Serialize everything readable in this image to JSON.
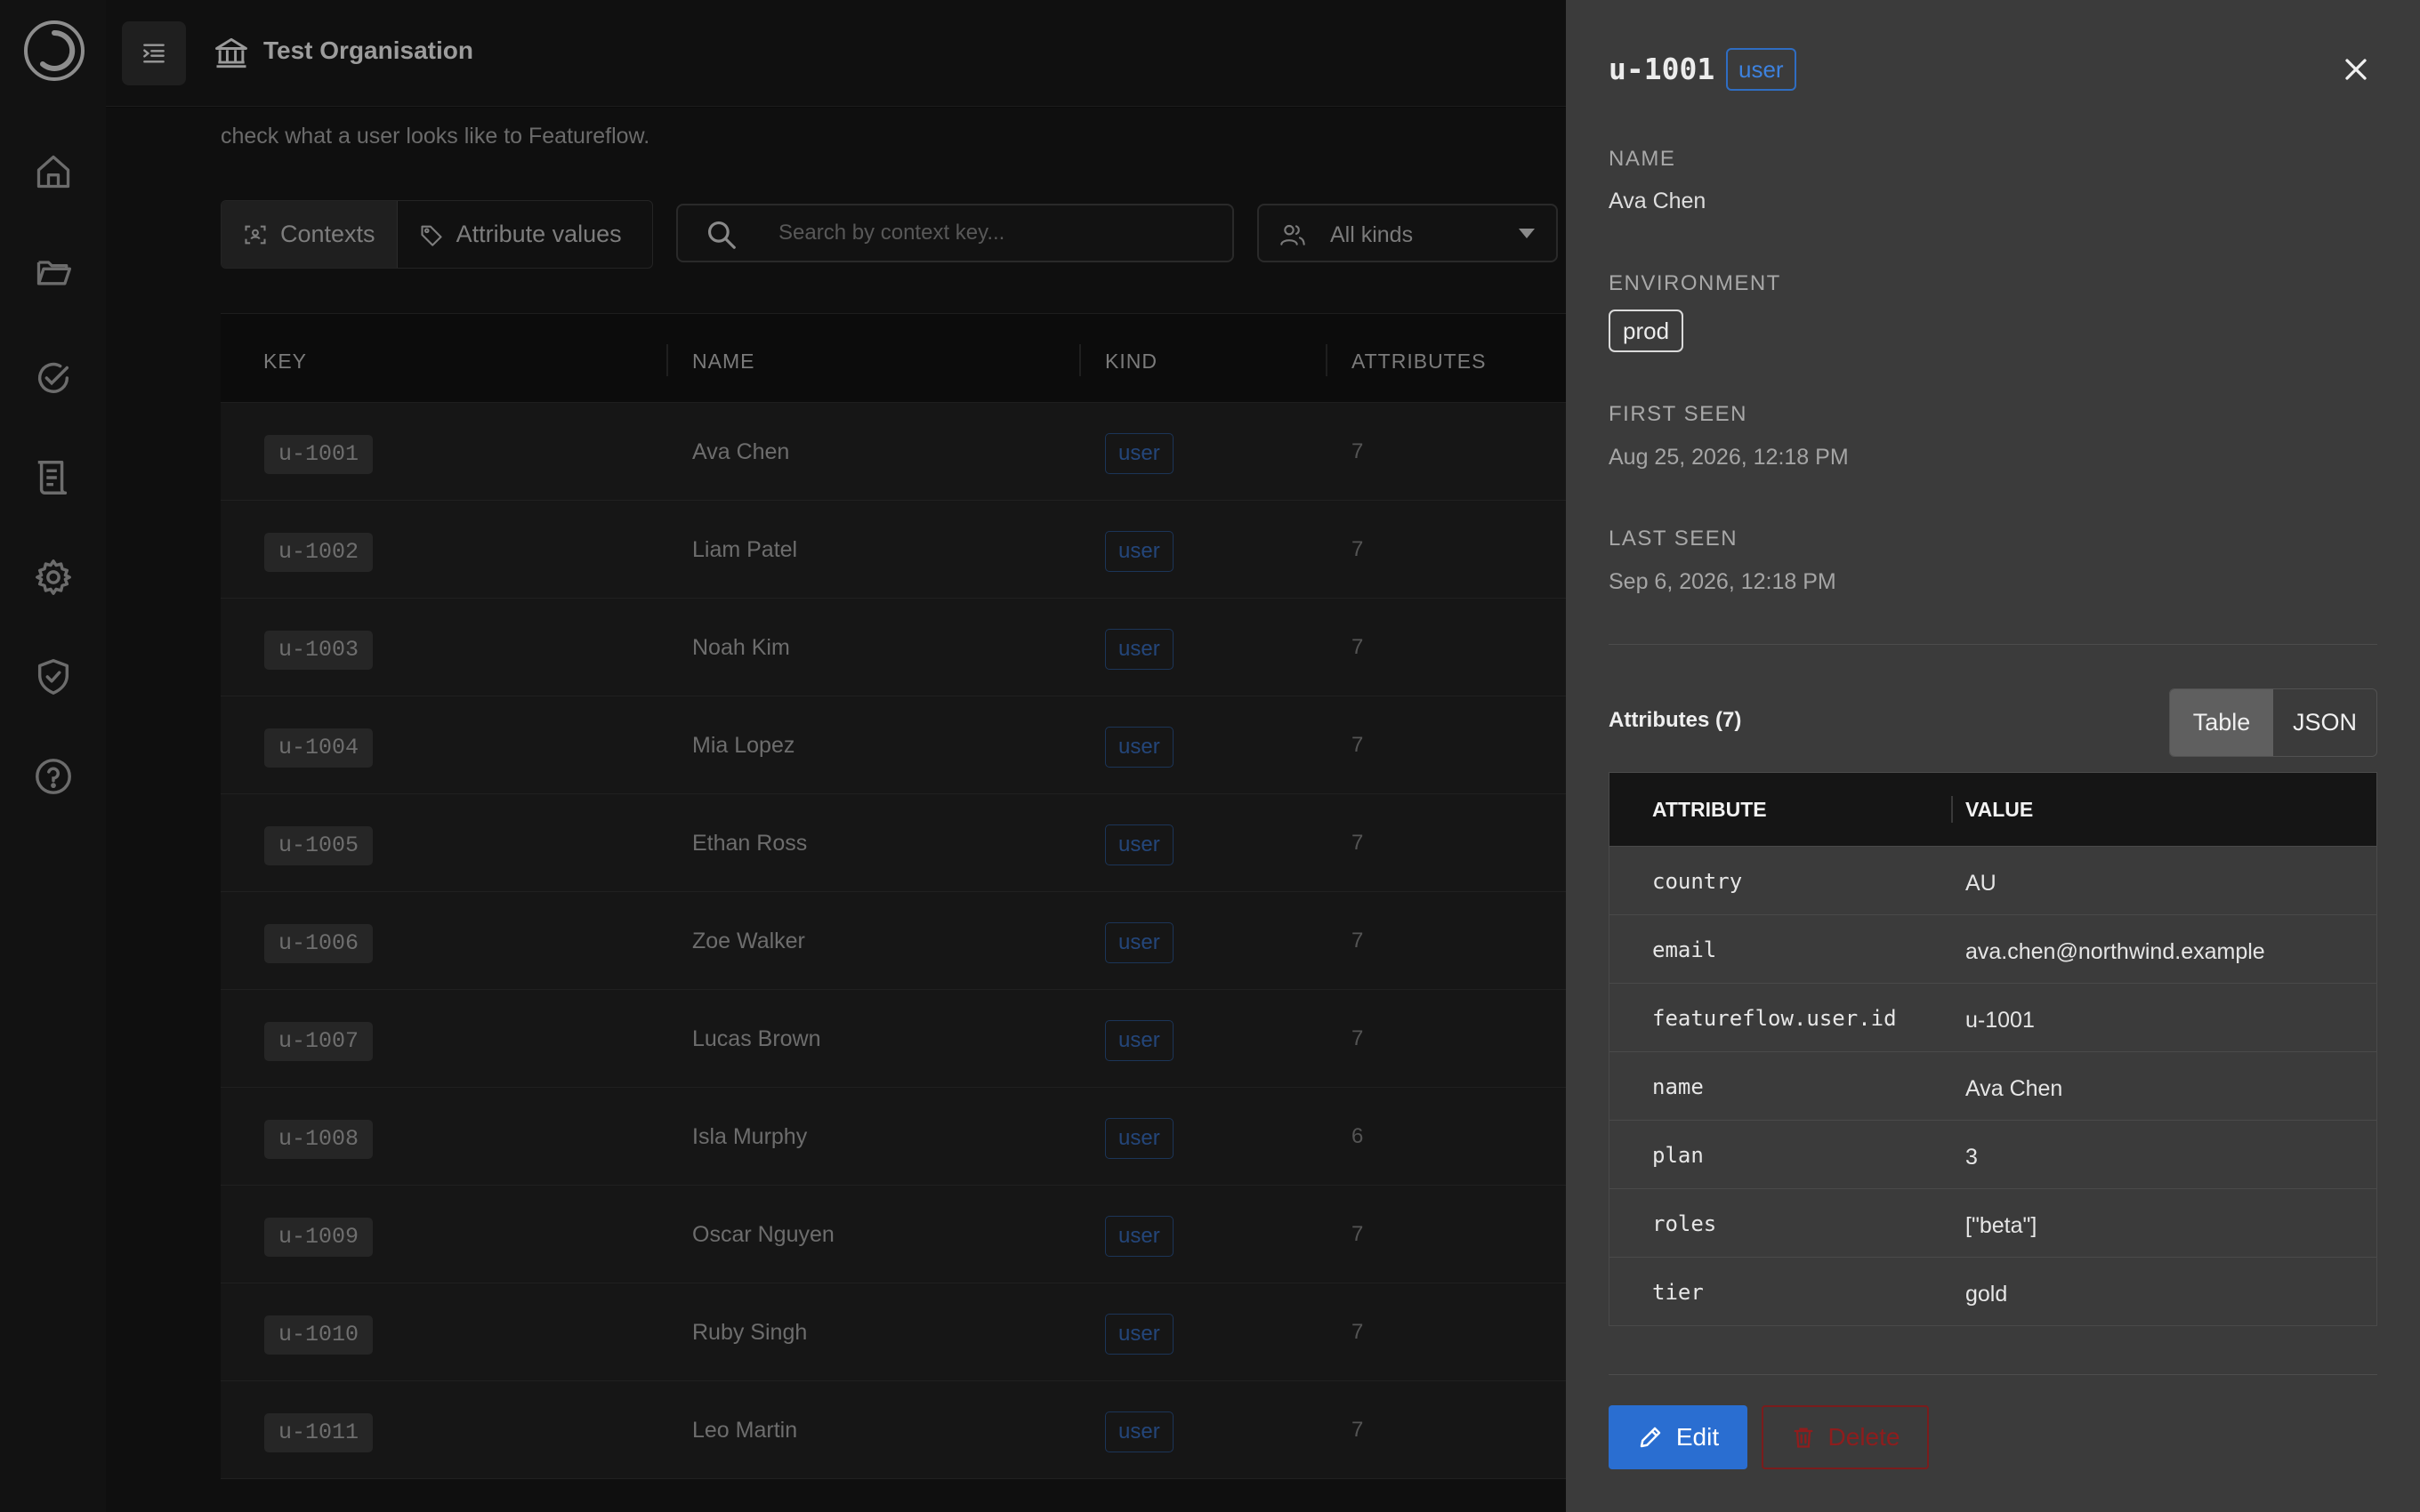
{
  "topbar": {
    "org_name": "Test Organisation"
  },
  "main": {
    "intro_text": "check what a user looks like to Featureflow.",
    "tabs": [
      {
        "label": "Contexts",
        "icon": "context-scan-icon",
        "active": true
      },
      {
        "label": "Attribute values",
        "icon": "tag-icon",
        "active": false
      }
    ],
    "search": {
      "placeholder": "Search by context key...",
      "value": ""
    },
    "kind_filter": {
      "selected": "All kinds"
    },
    "table": {
      "columns": [
        "KEY",
        "NAME",
        "KIND",
        "ATTRIBUTES"
      ],
      "rows": [
        {
          "key": "u-1001",
          "name": "Ava Chen",
          "kind": "user",
          "attributes": "7"
        },
        {
          "key": "u-1002",
          "name": "Liam Patel",
          "kind": "user",
          "attributes": "7"
        },
        {
          "key": "u-1003",
          "name": "Noah Kim",
          "kind": "user",
          "attributes": "7"
        },
        {
          "key": "u-1004",
          "name": "Mia Lopez",
          "kind": "user",
          "attributes": "7"
        },
        {
          "key": "u-1005",
          "name": "Ethan Ross",
          "kind": "user",
          "attributes": "7"
        },
        {
          "key": "u-1006",
          "name": "Zoe Walker",
          "kind": "user",
          "attributes": "7"
        },
        {
          "key": "u-1007",
          "name": "Lucas Brown",
          "kind": "user",
          "attributes": "7"
        },
        {
          "key": "u-1008",
          "name": "Isla Murphy",
          "kind": "user",
          "attributes": "6"
        },
        {
          "key": "u-1009",
          "name": "Oscar Nguyen",
          "kind": "user",
          "attributes": "7"
        },
        {
          "key": "u-1010",
          "name": "Ruby Singh",
          "kind": "user",
          "attributes": "7"
        },
        {
          "key": "u-1011",
          "name": "Leo Martin",
          "kind": "user",
          "attributes": "7"
        }
      ]
    }
  },
  "drawer": {
    "title": "u-1001",
    "kind": "user",
    "name_label": "NAME",
    "name_value": "Ava Chen",
    "env_label": "ENVIRONMENT",
    "env_value": "prod",
    "first_seen_label": "FIRST SEEN",
    "first_seen_value": "Aug 25, 2026, 12:18 PM",
    "last_seen_label": "LAST SEEN",
    "last_seen_value": "Sep 6, 2026, 12:18 PM",
    "attributes_title": "Attributes (7)",
    "view_toggle": {
      "table_label": "Table",
      "json_label": "JSON",
      "selected": "Table"
    },
    "attr_columns": [
      "ATTRIBUTE",
      "VALUE"
    ],
    "attributes": [
      {
        "key": "country",
        "value": "AU"
      },
      {
        "key": "email",
        "value": "ava.chen@northwind.example"
      },
      {
        "key": "featureflow.user.id",
        "value": "u-1001"
      },
      {
        "key": "name",
        "value": "Ava Chen"
      },
      {
        "key": "plan",
        "value": "3"
      },
      {
        "key": "roles",
        "value": "[\"beta\"]"
      },
      {
        "key": "tier",
        "value": "gold"
      }
    ],
    "edit_label": "Edit",
    "delete_label": "Delete"
  },
  "colors": {
    "accent": "#2a6ed1",
    "kind_badge": "#3d82df",
    "danger": "#8e1d1d",
    "drawer_bg": "#3b3b3b"
  }
}
